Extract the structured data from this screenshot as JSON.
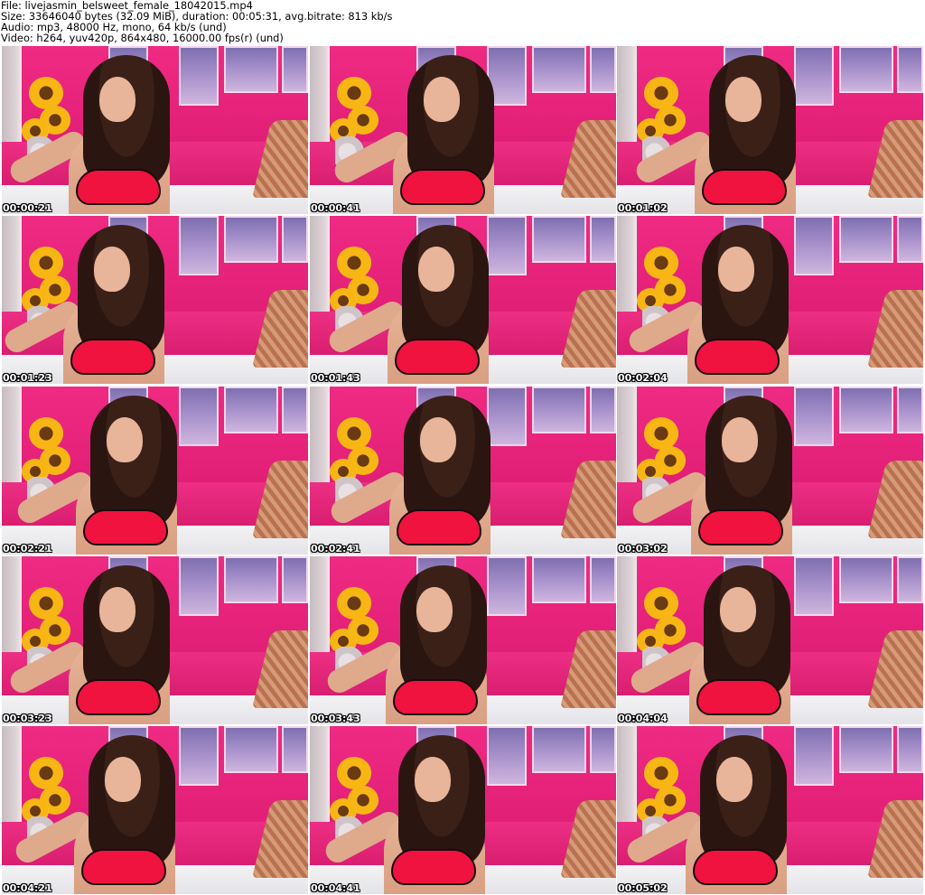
{
  "header": {
    "file": "File: livejasmin_belsweet_female_18042015.mp4",
    "size": "Size: 33646040 bytes (32.09 MiB), duration: 00:05:31, avg.bitrate: 813 kb/s",
    "audio": "Audio: mp3, 48000 Hz, mono, 64 kb/s (und)",
    "video": "Video: h264, yuv420p, 864x480, 16000.00 fps(r) (und)"
  },
  "thumbnails": [
    {
      "timestamp": "00:00:21"
    },
    {
      "timestamp": "00:00:41"
    },
    {
      "timestamp": "00:01:02"
    },
    {
      "timestamp": "00:01:23"
    },
    {
      "timestamp": "00:01:43"
    },
    {
      "timestamp": "00:02:04"
    },
    {
      "timestamp": "00:02:21"
    },
    {
      "timestamp": "00:02:41"
    },
    {
      "timestamp": "00:03:02"
    },
    {
      "timestamp": "00:03:23"
    },
    {
      "timestamp": "00:03:43"
    },
    {
      "timestamp": "00:04:04"
    },
    {
      "timestamp": "00:04:21"
    },
    {
      "timestamp": "00:04:41"
    },
    {
      "timestamp": "00:05:02"
    }
  ]
}
